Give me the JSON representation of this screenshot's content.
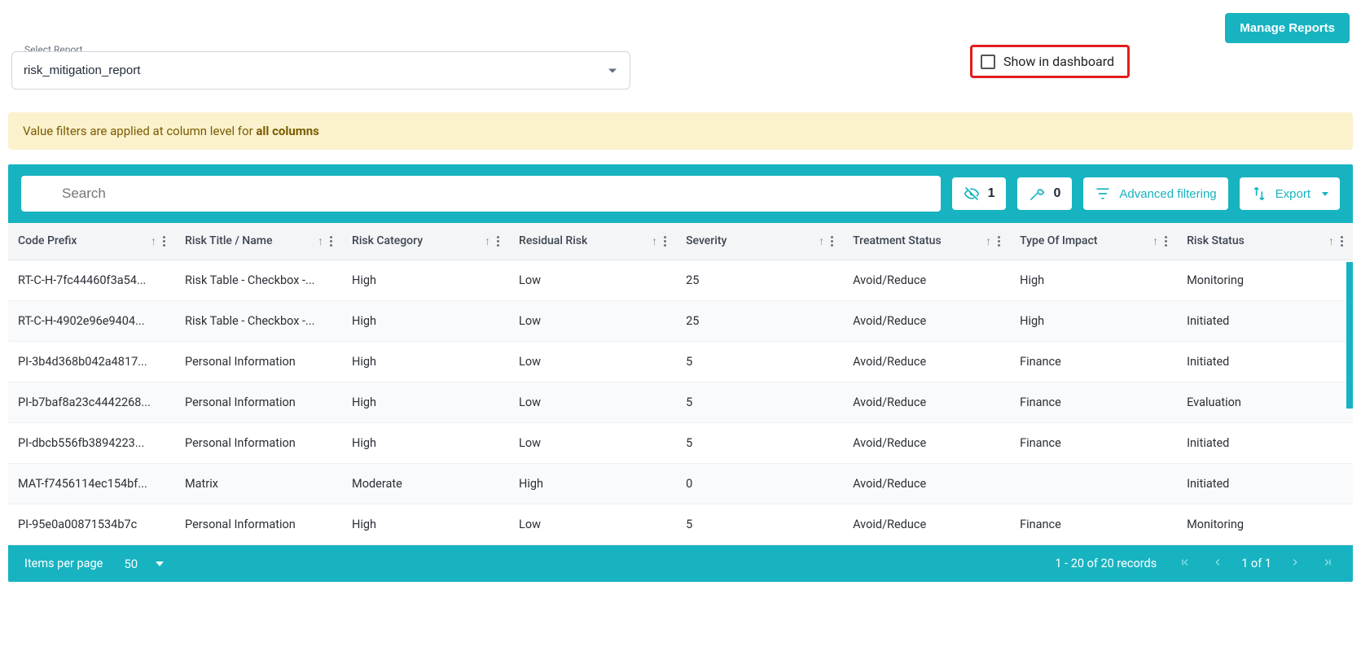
{
  "buttons": {
    "manage_reports": "Manage Reports",
    "advanced_filtering": "Advanced filtering",
    "export": "Export"
  },
  "select_report": {
    "label": "Select Report",
    "value": "risk_mitigation_report"
  },
  "show_in_dashboard": {
    "label": "Show in dashboard",
    "checked": false
  },
  "banner": {
    "prefix": "Value filters are applied at column level for ",
    "bold": "all columns"
  },
  "search": {
    "placeholder": "Search"
  },
  "counters": {
    "hidden_columns": "1",
    "tools": "0"
  },
  "columns": [
    "Code Prefix",
    "Risk Title / Name",
    "Risk Category",
    "Residual Risk",
    "Severity",
    "Treatment Status",
    "Type Of Impact",
    "Risk Status"
  ],
  "rows": [
    {
      "code": "RT-C-H-7fc44460f3a54...",
      "title": "Risk Table - Checkbox -...",
      "category": "High",
      "residual": "Low",
      "severity": "25",
      "treatment": "Avoid/Reduce",
      "impact": "High",
      "status": "Monitoring"
    },
    {
      "code": "RT-C-H-4902e96e9404...",
      "title": "Risk Table - Checkbox -...",
      "category": "High",
      "residual": "Low",
      "severity": "25",
      "treatment": "Avoid/Reduce",
      "impact": "High",
      "status": "Initiated"
    },
    {
      "code": "PI-3b4d368b042a4817...",
      "title": "Personal Information",
      "category": "High",
      "residual": "Low",
      "severity": "5",
      "treatment": "Avoid/Reduce",
      "impact": "Finance",
      "status": "Initiated"
    },
    {
      "code": "PI-b7baf8a23c4442268...",
      "title": "Personal Information",
      "category": "High",
      "residual": "Low",
      "severity": "5",
      "treatment": "Avoid/Reduce",
      "impact": "Finance",
      "status": "Evaluation"
    },
    {
      "code": "PI-dbcb556fb3894223...",
      "title": "Personal Information",
      "category": "High",
      "residual": "Low",
      "severity": "5",
      "treatment": "Avoid/Reduce",
      "impact": "Finance",
      "status": "Initiated"
    },
    {
      "code": "MAT-f7456114ec154bf...",
      "title": "Matrix",
      "category": "Moderate",
      "residual": "High",
      "severity": "0",
      "treatment": "Avoid/Reduce",
      "impact": "",
      "status": "Initiated"
    },
    {
      "code": "PI-95e0a00871534b7c",
      "title": "Personal Information",
      "category": "High",
      "residual": "Low",
      "severity": "5",
      "treatment": "Avoid/Reduce",
      "impact": "Finance",
      "status": "Monitoring"
    }
  ],
  "footer": {
    "items_per_page_label": "Items per page",
    "items_per_page_value": "50",
    "records": "1 - 20 of 20 records",
    "page_info": "1 of 1"
  }
}
